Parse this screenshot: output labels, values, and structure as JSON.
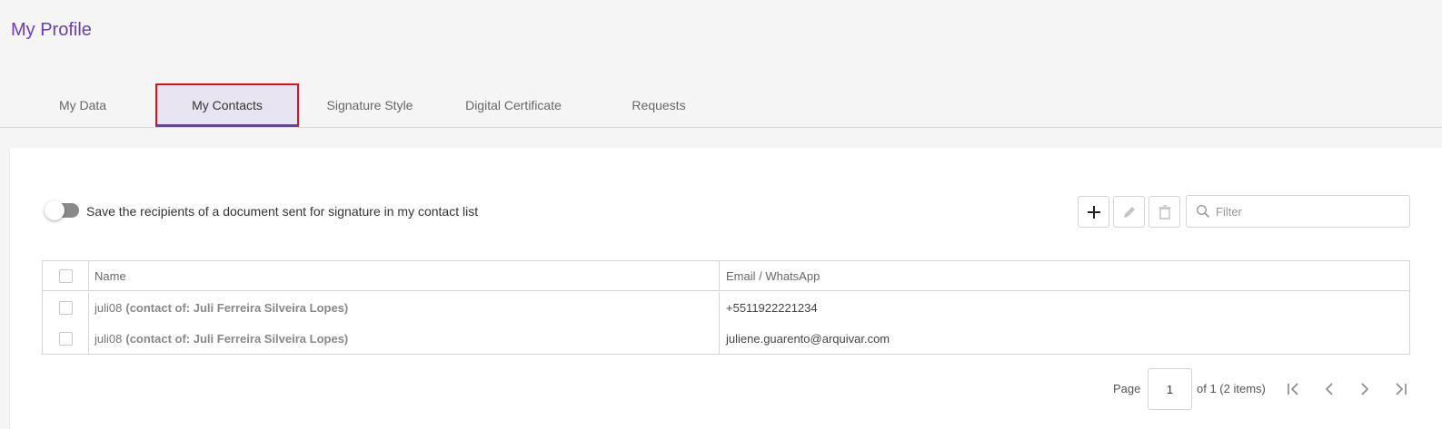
{
  "page": {
    "title": "My Profile"
  },
  "tabs": [
    {
      "label": "My Data",
      "active": false
    },
    {
      "label": "My Contacts",
      "active": true
    },
    {
      "label": "Signature Style",
      "active": false
    },
    {
      "label": "Digital Certificate",
      "active": false
    },
    {
      "label": "Requests",
      "active": false
    }
  ],
  "settings": {
    "save_recipients_label": "Save the recipients of a document sent for signature in my contact list",
    "save_recipients_enabled": false
  },
  "toolbar": {
    "add_icon": "plus-icon",
    "edit_icon": "pencil-icon",
    "delete_icon": "trash-icon",
    "filter_placeholder": "Filter",
    "filter_value": ""
  },
  "table": {
    "columns": [
      "Name",
      "Email / WhatsApp"
    ],
    "rows": [
      {
        "name": "juli08",
        "owner": "(contact of: Juli Ferreira Silveira Lopes)",
        "contact": "+5511922221234"
      },
      {
        "name": "juli08",
        "owner": "(contact of: Juli Ferreira Silveira Lopes)",
        "contact": "juliene.guarento@arquivar.com"
      }
    ]
  },
  "pagination": {
    "page_label": "Page",
    "current_page": "1",
    "of_label": "of 1 (2 items)"
  },
  "colors": {
    "accent": "#6a3fb5",
    "highlight_border": "#e0101a",
    "active_tab_bg": "#e9e4f1"
  }
}
